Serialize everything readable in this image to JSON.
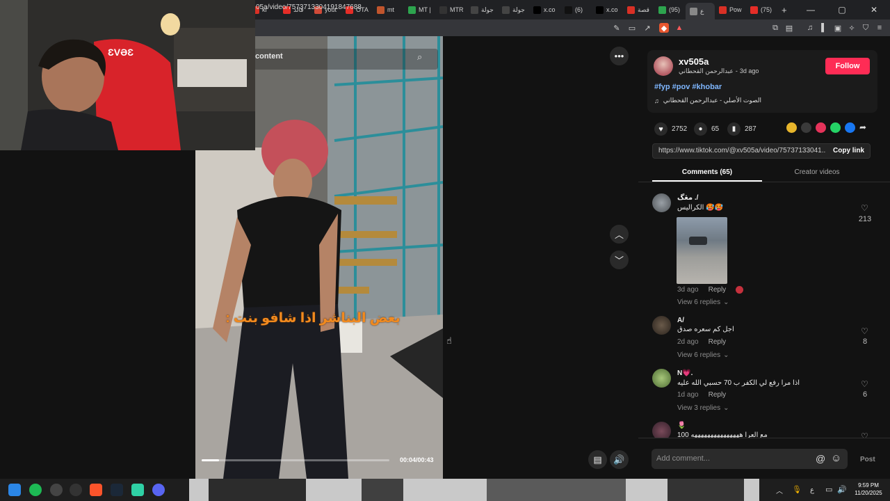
{
  "browser": {
    "tabs": [
      {
        "label": "ki",
        "fav": "#d93025"
      },
      {
        "label": "قالد",
        "fav": "#e52d27"
      },
      {
        "label": "yout",
        "fav": "#d04a38"
      },
      {
        "label": "OTA",
        "fav": "#e52d27"
      },
      {
        "label": "mt",
        "fav": "#c1552d"
      },
      {
        "label": "MT |",
        "fav": "#2da44e"
      },
      {
        "label": "MTR",
        "fav": "#333"
      },
      {
        "label": "جولة",
        "fav": "#444"
      },
      {
        "label": "جولة",
        "fav": "#444"
      },
      {
        "label": "x.co",
        "fav": "#000"
      },
      {
        "label": "(6)",
        "fav": "#111"
      },
      {
        "label": "x.co",
        "fav": "#000"
      },
      {
        "label": "قصة",
        "fav": "#d93025"
      },
      {
        "label": "(95)",
        "fav": "#2da44e"
      },
      {
        "label": "ع",
        "fav": "#888"
      },
      {
        "label": "Pow",
        "fav": "#d93025"
      },
      {
        "label": "(75)",
        "fav": "#e52d27"
      }
    ],
    "new_tab_glyph": "+",
    "url": "05a/video/7573713304191847688",
    "window_controls": {
      "minimize": "—",
      "maximize": "▢",
      "close": "✕"
    }
  },
  "video": {
    "search_placeholder": "content",
    "caption": "بعض البناشر اذا شافو بنت :",
    "time": "00:04/00:43",
    "progress_fraction": 0.093,
    "more_glyph": "•••",
    "up_glyph": "︿",
    "down_glyph": "﹀"
  },
  "author": {
    "username": "xv505a",
    "display_name": "عبدالرحمن القحطاني",
    "time_ago": "3d ago",
    "follow_label": "Follow",
    "hashtags": "#fyp #pov #khobar",
    "sound": "الصوت الأصلي - عبدالرحمن القحطاني"
  },
  "stats": {
    "likes": "2752",
    "comments": "65",
    "saves": "287"
  },
  "share_colors": [
    "#e7b52b",
    "#3a3a3a",
    "#e5335a",
    "#25d366",
    "#1877f2"
  ],
  "link": {
    "url": "https://www.tiktok.com/@xv505a/video/75737133041...",
    "copy_label": "Copy link"
  },
  "tabs": {
    "comments": "Comments (65)",
    "creator": "Creator videos"
  },
  "comments": [
    {
      "name": "مڠگ ./",
      "text": "الكراليس 🥵🥵",
      "time": "3d ago",
      "reply": "Reply",
      "likes": "213",
      "replies": "View 6 replies"
    },
    {
      "name": "A/",
      "text": "اجل كم سعره صدق",
      "time": "2d ago",
      "reply": "Reply",
      "likes": "8",
      "replies": "View 6 replies"
    },
    {
      "name": "N💗.",
      "text": "اذا مرا رفع لي الكفر ب 70 حسبي الله عليه",
      "time": "1d ago",
      "reply": "Reply",
      "likes": "6",
      "replies": "View 3 replies"
    },
    {
      "name": "🌷",
      "text": "100 مع العرا هههههههههههههههه"
    }
  ],
  "comment_box": {
    "placeholder": "Add comment...",
    "at_glyph": "@",
    "post_label": "Post"
  },
  "taskbar": {
    "time": "9:59 PM",
    "date": "11/20/2025",
    "lang": "ع"
  }
}
